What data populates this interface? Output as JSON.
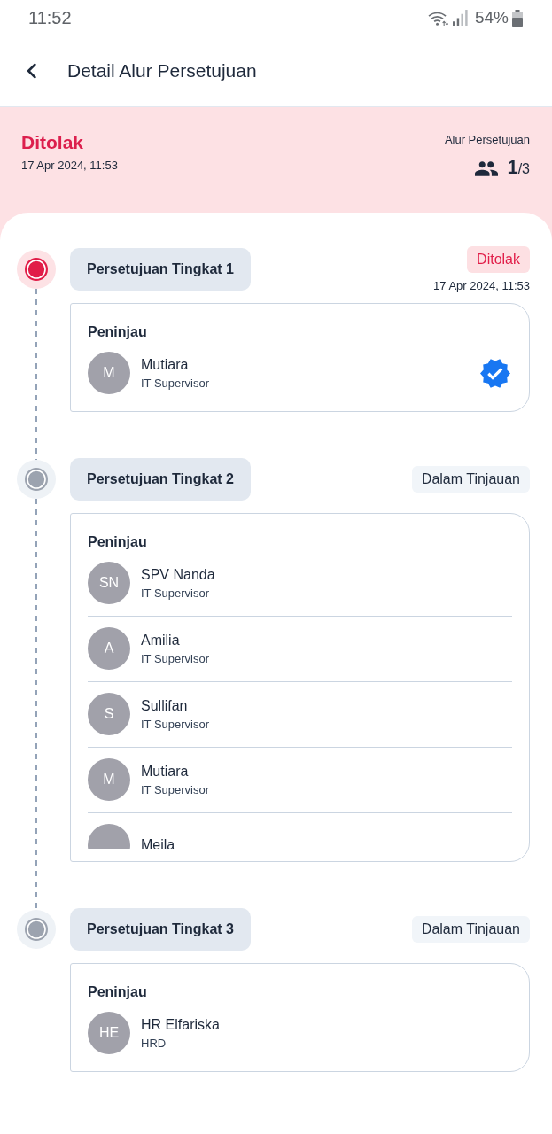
{
  "status_bar": {
    "time": "11:52",
    "battery": "54%"
  },
  "app_bar": {
    "title": "Detail Alur Persetujuan"
  },
  "summary": {
    "kind": "rejected",
    "status_label": "Ditolak",
    "date": "17 Apr 2024, 11:53",
    "flow_label": "Alur Persetujuan",
    "current": "1",
    "total": "/3"
  },
  "steps": [
    {
      "title": "Persetujuan Tingkat 1",
      "kind": "rejected",
      "badge": "Ditolak",
      "date": "17 Apr 2024, 11:53",
      "reviewers_label": "Peninjau",
      "reviewers": [
        {
          "initials": "M",
          "name": "Mutiara",
          "role": "IT Supervisor",
          "verified": true
        }
      ]
    },
    {
      "title": "Persetujuan Tingkat 2",
      "kind": "in_review",
      "badge": "Dalam Tinjauan",
      "reviewers_label": "Peninjau",
      "reviewers": [
        {
          "initials": "SN",
          "name": "SPV Nanda",
          "role": "IT Supervisor",
          "verified": false
        },
        {
          "initials": "A",
          "name": "Amilia",
          "role": "IT Supervisor",
          "verified": false
        },
        {
          "initials": "S",
          "name": "Sullifan",
          "role": "IT Supervisor",
          "verified": false
        },
        {
          "initials": "M",
          "name": "Mutiara",
          "role": "IT Supervisor",
          "verified": false
        },
        {
          "name": "Meila",
          "verified": false
        }
      ]
    },
    {
      "title": "Persetujuan Tingkat 3",
      "kind": "in_review",
      "badge": "Dalam Tinjauan",
      "reviewers_label": "Peninjau",
      "reviewers": [
        {
          "initials": "HE",
          "name": "HR Elfariska",
          "role": "HRD",
          "verified": false
        }
      ]
    }
  ]
}
